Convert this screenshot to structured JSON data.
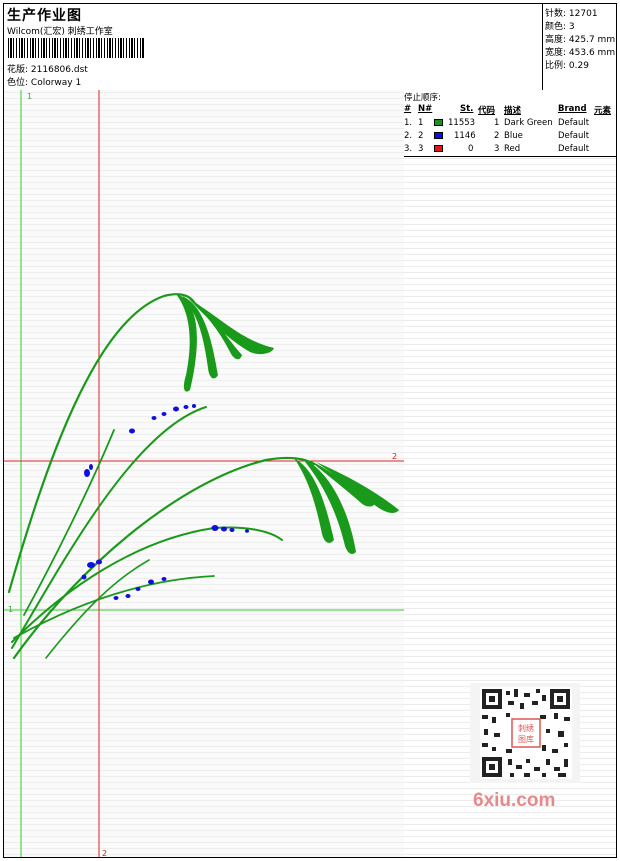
{
  "header": {
    "title": "生产作业图",
    "company": "Wilcom(汇宏) 刺绣工作室",
    "design_label": "花版:",
    "design_value": "2116806.dst",
    "colorway_label": "色位:",
    "colorway_value": "Colorway 1"
  },
  "stats": {
    "stitches_label": "针数:",
    "stitches_value": "12701",
    "colors_label": "颜色:",
    "colors_value": "3",
    "height_label": "高度:",
    "height_value": "425.7 mm",
    "width_label": "宽度:",
    "width_value": "453.6 mm",
    "scale_label": "比例:",
    "scale_value": "0.29"
  },
  "canvas": {
    "marker_1_top": "1",
    "marker_1_left": "1",
    "marker_2_right": "2",
    "marker_2_bottom": "2",
    "guide_colors": {
      "green": "#33cc33",
      "red": "#dd2222"
    },
    "design_colors": {
      "green": "#1a9a1a",
      "blue": "#1010dd"
    }
  },
  "stop_sequence": {
    "label": "停止顺序:",
    "columns": [
      "#",
      "N#",
      "St.",
      "代码",
      "描述",
      "Brand",
      "元素"
    ],
    "rows": [
      {
        "index": "1.",
        "n": "1",
        "color": "#14961e",
        "stitches": "11553",
        "code": "1",
        "description": "Dark Green",
        "brand": "Default"
      },
      {
        "index": "2.",
        "n": "2",
        "color": "#1010dd",
        "stitches": "1146",
        "code": "2",
        "description": "Blue",
        "brand": "Default"
      },
      {
        "index": "3.",
        "n": "3",
        "color": "#ee1111",
        "stitches": "0",
        "code": "3",
        "description": "Red",
        "brand": "Default"
      }
    ]
  },
  "watermark": {
    "site": "6xiu.com",
    "seal": "刺绣图库",
    "color": "#e8888a"
  }
}
